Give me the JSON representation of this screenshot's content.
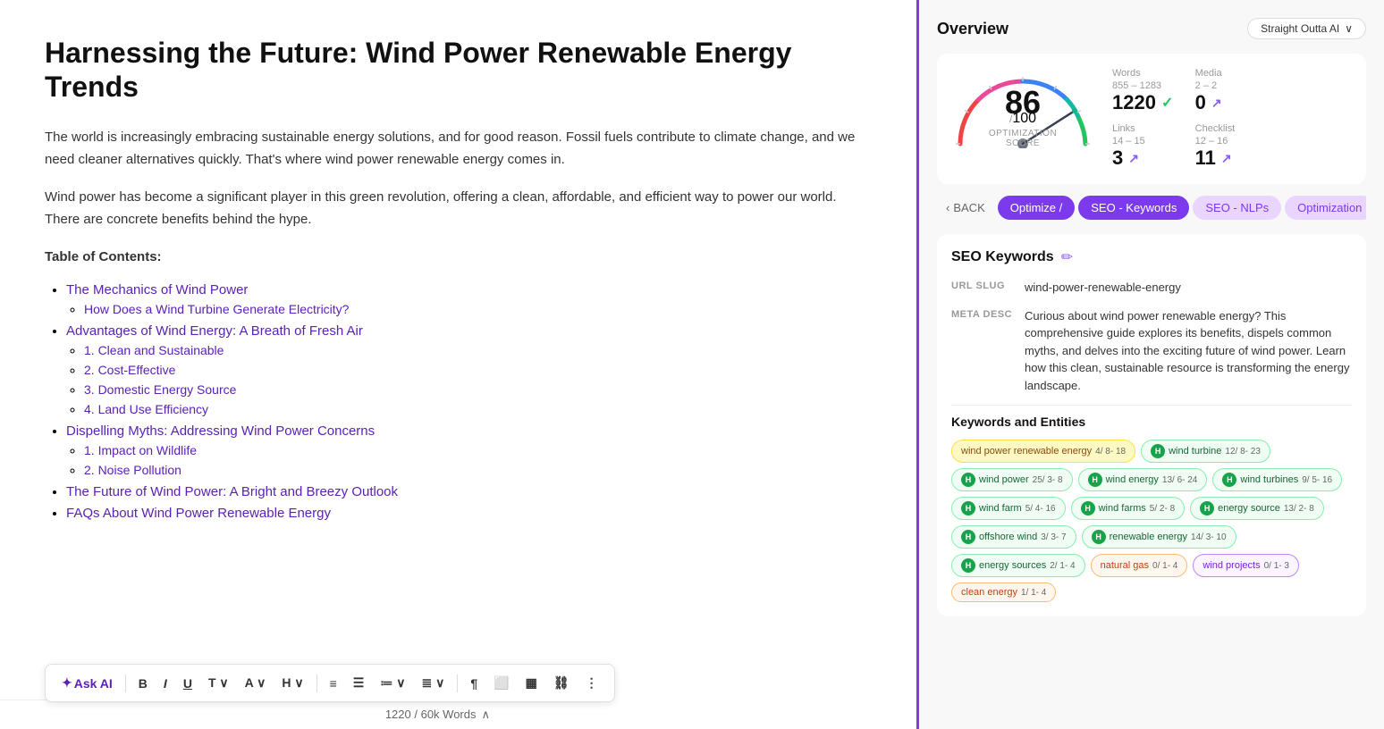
{
  "editor": {
    "title": "Harnessing the Future: Wind Power Renewable Energy Trends",
    "intro1": "The world is increasingly embracing sustainable energy solutions, and for good reason. Fossil fuels contribute to climate change, and we need cleaner alternatives quickly. That's where wind power renewable energy comes in.",
    "intro2": "Wind power has become a significant player in this green revolution, offering a clean, affordable, and efficient way to power our world. There are concrete benefits behind the hype.",
    "toc_heading": "Table of Contents:",
    "toc_items": [
      {
        "label": "The Mechanics of Wind Power",
        "sub": [
          "How Does a Wind Turbine Generate Electricity?"
        ]
      },
      {
        "label": "Advantages of Wind Energy: A Breath of Fresh Air",
        "sub": [
          "1. Clean and Sustainable",
          "2. Cost-Effective",
          "3. Domestic Energy Source",
          "4. Land Use Efficiency"
        ]
      },
      {
        "label": "Dispelling Myths: Addressing Wind Power Concerns",
        "sub": [
          "1. Impact on Wildlife",
          "2. Noise Pollution"
        ]
      },
      {
        "label": "The Future of Wind Power: A Bright and Breezy Outlook",
        "sub": []
      },
      {
        "label": "FAQs About Wind Power Renewable Energy",
        "sub": []
      }
    ],
    "word_count": "1220 / 60k Words"
  },
  "toolbar": {
    "ask_ai": "Ask AI",
    "bold": "B",
    "italic": "I",
    "underline": "U"
  },
  "overview": {
    "title": "Overview",
    "source_label": "Straight Outta AI",
    "score": "86",
    "score_max": "100",
    "score_label": "OPTIMIZATION SCORE",
    "stats": [
      {
        "label": "Words",
        "range": "855 - 1283",
        "value": "1220",
        "icon": "check"
      },
      {
        "label": "Media",
        "range": "2 - 2",
        "value": "0",
        "icon": "arrow"
      },
      {
        "label": "Links",
        "range": "14 - 15",
        "value": "3",
        "icon": "arrow"
      },
      {
        "label": "Checklist",
        "range": "12 - 16",
        "value": "11",
        "icon": "arrow"
      }
    ]
  },
  "tabs": [
    {
      "label": "< BACK",
      "type": "back"
    },
    {
      "label": "Optimize /",
      "type": "active"
    },
    {
      "label": "SEO - Keywords",
      "type": "active"
    },
    {
      "label": "SEO - NLPs",
      "type": "inactive"
    },
    {
      "label": "Optimization",
      "type": "inactive"
    }
  ],
  "seo": {
    "title": "SEO Keywords",
    "url_slug_label": "URL SLUG",
    "url_slug_value": "wind-power-renewable-energy",
    "meta_desc_label": "META DESC",
    "meta_desc_value": "Curious about wind power renewable energy? This comprehensive guide explores its benefits, dispels common myths, and delves into the exciting future of wind power. Learn how this clean, sustainable resource is transforming the energy landscape.",
    "keywords_title": "Keywords and Entities",
    "keywords": [
      {
        "label": "wind power renewable energy",
        "stats": "4/ 8- 18",
        "type": "primary",
        "badge": null
      },
      {
        "label": "wind turbine",
        "stats": "12/ 8- 23",
        "type": "secondary",
        "badge": "H"
      },
      {
        "label": "wind power",
        "stats": "25/ 3- 8",
        "type": "secondary",
        "badge": "H"
      },
      {
        "label": "wind energy",
        "stats": "13/ 6- 24",
        "type": "secondary",
        "badge": "H"
      },
      {
        "label": "wind turbines",
        "stats": "9/ 5- 16",
        "type": "secondary",
        "badge": "H"
      },
      {
        "label": "wind farm",
        "stats": "5/ 4- 16",
        "type": "secondary",
        "badge": "H"
      },
      {
        "label": "wind farms",
        "stats": "5/ 2- 8",
        "type": "secondary",
        "badge": "H"
      },
      {
        "label": "energy source",
        "stats": "13/ 2- 8",
        "type": "secondary",
        "badge": "H"
      },
      {
        "label": "offshore wind",
        "stats": "3/ 3- 7",
        "type": "secondary",
        "badge": "H"
      },
      {
        "label": "renewable energy",
        "stats": "14/ 3- 10",
        "type": "secondary",
        "badge": "H"
      },
      {
        "label": "energy sources",
        "stats": "2/ 1- 4",
        "type": "secondary",
        "badge": "H"
      },
      {
        "label": "natural gas",
        "stats": "0/ 1- 4",
        "type": "highlight-red",
        "badge": null
      },
      {
        "label": "wind projects",
        "stats": "0/ 1- 3",
        "type": "highlight-purple",
        "badge": null
      },
      {
        "label": "clean energy",
        "stats": "1/ 1- 4",
        "type": "highlight-red",
        "badge": null
      }
    ]
  }
}
